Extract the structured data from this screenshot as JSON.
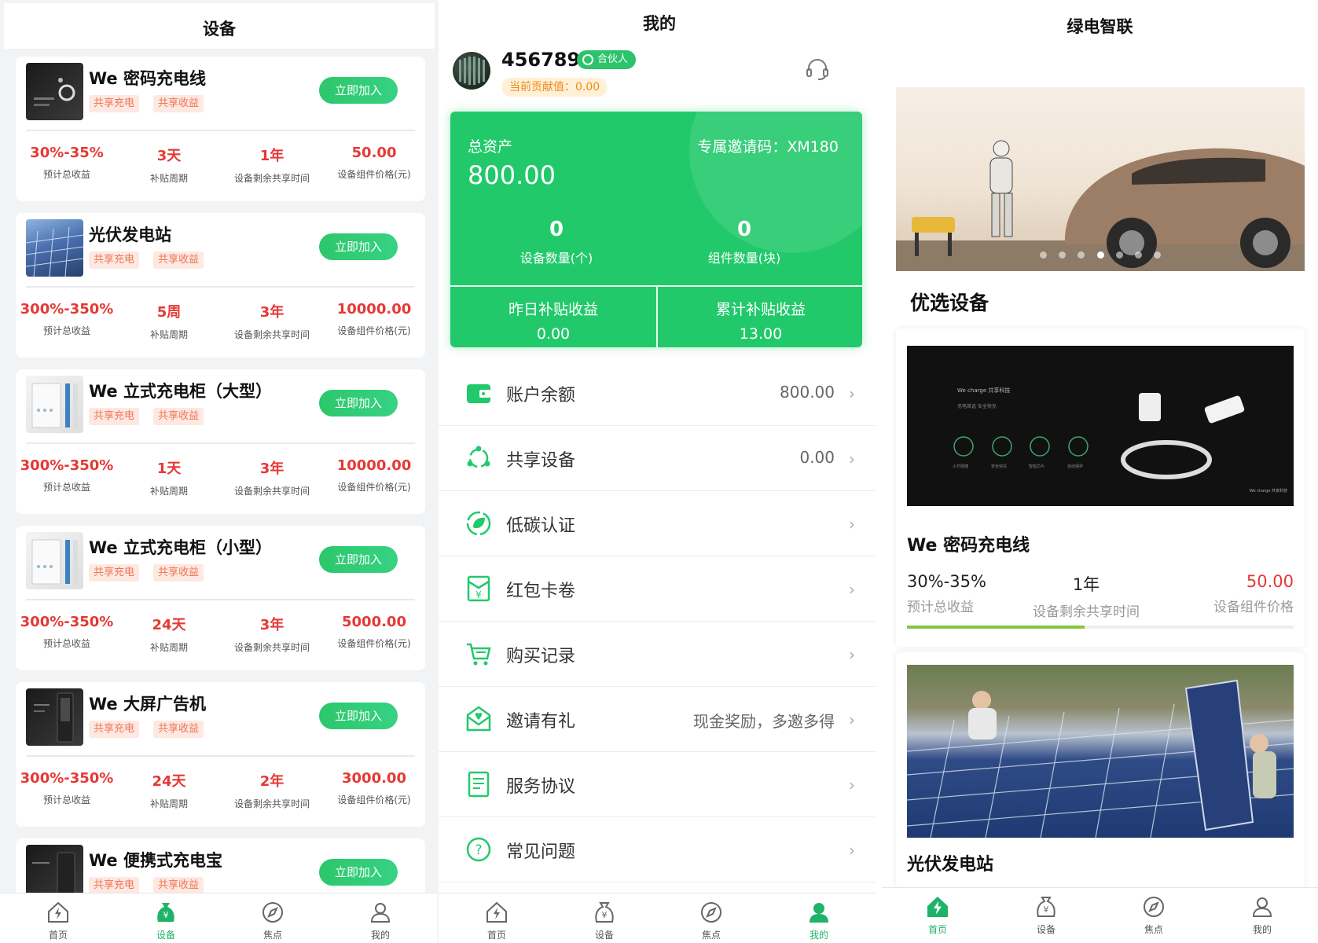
{
  "screen_equipment": {
    "title": "设备",
    "join_label": "立即加入",
    "stat_labels": [
      "预计总收益",
      "补贴周期",
      "设备剩余共享时间",
      "设备组件价格(元)"
    ],
    "devices": [
      {
        "name": "We 密码充电线",
        "tags": [
          "共享充电",
          "共享收益"
        ],
        "yield": "30%-35%",
        "cycle": "3天",
        "remaining": "1年",
        "price": "50.00"
      },
      {
        "name": "光伏发电站",
        "tags": [
          "共享充电",
          "共享收益"
        ],
        "yield": "300%-350%",
        "cycle": "5周",
        "remaining": "3年",
        "price": "10000.00"
      },
      {
        "name": "We 立式充电柜（大型）",
        "tags": [
          "共享充电",
          "共享收益"
        ],
        "yield": "300%-350%",
        "cycle": "1天",
        "remaining": "3年",
        "price": "10000.00"
      },
      {
        "name": "We 立式充电柜（小型）",
        "tags": [
          "共享充电",
          "共享收益"
        ],
        "yield": "300%-350%",
        "cycle": "24天",
        "remaining": "3年",
        "price": "5000.00"
      },
      {
        "name": "We 大屏广告机",
        "tags": [
          "共享充电",
          "共享收益"
        ],
        "yield": "300%-350%",
        "cycle": "24天",
        "remaining": "2年",
        "price": "3000.00"
      },
      {
        "name": "We 便携式充电宝",
        "tags": [
          "共享充电",
          "共享收益"
        ]
      }
    ]
  },
  "tabbar": {
    "home": "首页",
    "equipment": "设备",
    "focus": "焦点",
    "mine": "我的"
  },
  "screen_mine": {
    "title": "我的",
    "user_id": "456789",
    "badge": "合伙人",
    "contribution": "当前贡献值：0.00",
    "assets": {
      "total_label": "总资产",
      "total_value": "800.00",
      "invite_code": "专属邀请码：XM180",
      "device_count": "0",
      "device_count_label": "设备数量(个)",
      "module_count": "0",
      "module_count_label": "组件数量(块)",
      "yesterday_label": "昨日补贴收益",
      "yesterday_value": "0.00",
      "cumulative_label": "累计补贴收益",
      "cumulative_value": "13.00"
    },
    "menu": [
      {
        "label": "账户余额",
        "value": "800.00",
        "icon": "wallet-icon"
      },
      {
        "label": "共享设备",
        "value": "0.00",
        "icon": "share-icon"
      },
      {
        "label": "低碳认证",
        "value": "",
        "icon": "leaf-icon"
      },
      {
        "label": "红包卡卷",
        "value": "",
        "icon": "red-packet-icon"
      },
      {
        "label": "购买记录",
        "value": "",
        "icon": "cart-icon"
      },
      {
        "label": "邀请有礼",
        "value": "现金奖励，多邀多得",
        "icon": "gift-mail-icon"
      },
      {
        "label": "服务协议",
        "value": "",
        "icon": "document-icon"
      },
      {
        "label": "常见问题",
        "value": "",
        "icon": "question-icon"
      }
    ]
  },
  "screen_home": {
    "title": "绿电智联",
    "section_title": "优选设备",
    "banner_dots": 7,
    "banner_active_dot": 3,
    "featured": [
      {
        "name": "We 密码充电线",
        "yield": "30%-35%",
        "yield_label": "预计总收益",
        "remaining": "1年",
        "remaining_label": "设备剩余共享时间",
        "price": "50.00",
        "price_label": "设备组件价格",
        "progress": 0.46,
        "image_text": {
          "brand": "We charge 共享科技",
          "sub": "充电首选 安全快充",
          "icons": [
            "小巧便捷",
            "安全快充",
            "智能芯片",
            "自动保护"
          ],
          "corner": "We charge 共享科技"
        }
      },
      {
        "name": "光伏发电站"
      }
    ]
  },
  "colors": {
    "brand_green": "#22c96b",
    "price_red": "#e53935",
    "tag_orange": "#f07654"
  }
}
